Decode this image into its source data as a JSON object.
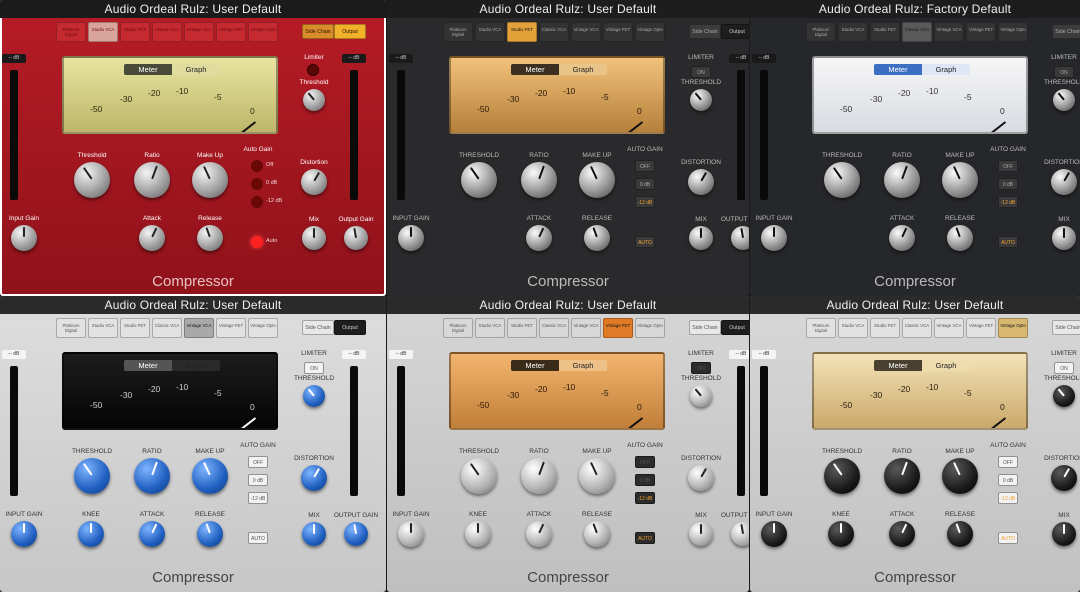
{
  "shared": {
    "tabs": [
      "Platinum Digital",
      "Studio VCA",
      "Studio FET",
      "Classic VCA",
      "Vintage VCA",
      "Vintage FET",
      "Vintage Opto"
    ],
    "side_chain": "Side Chain",
    "output": "Output",
    "meter": "Meter",
    "graph": "Graph",
    "scale": [
      "-50",
      "-30",
      "-20",
      "-10",
      "-5",
      "0"
    ],
    "footer": "Compressor",
    "db": "-- dB",
    "labels_upper": {
      "threshold": "THRESHOLD",
      "ratio": "RATIO",
      "makeup": "MAKE UP",
      "autogain": "AUTO GAIN",
      "attack": "ATTACK",
      "release": "RELEASE",
      "knee": "KNEE",
      "limiter": "LIMITER",
      "distortion": "DISTORTION",
      "mix": "MIX",
      "input_gain": "INPUT GAIN",
      "output_gain": "OUTPUT GAIN"
    },
    "labels_mixed": {
      "threshold": "Threshold",
      "ratio": "Ratio",
      "makeup": "Make Up",
      "autogain": "Auto Gain",
      "attack": "Attack",
      "release": "Release",
      "limiter": "Limiter",
      "distortion": "Distortion",
      "mix": "Mix",
      "input_gain": "Input Gain",
      "output_gain": "Output Gain"
    },
    "autogain_options": [
      "Off",
      "0 dB",
      "-12 dB",
      "Auto"
    ],
    "autogain_options_upper": [
      "OFF",
      "0 dB",
      "-12 dB",
      "AUTO"
    ],
    "on": "ON"
  },
  "panels": [
    {
      "title": "Audio Ordeal Rulz: User Default",
      "theme": "red",
      "active_tab": 1,
      "selected": true,
      "case": "mixed"
    },
    {
      "title": "Audio Ordeal Rulz: User Default",
      "theme": "dark",
      "active_tab": 2,
      "selected": false,
      "case": "upper"
    },
    {
      "title": "Audio Ordeal Rulz: Factory Default",
      "theme": "darkblue",
      "active_tab": 3,
      "selected": false,
      "case": "upper"
    },
    {
      "title": "Audio Ordeal Rulz: User Default",
      "theme": "silverblue",
      "active_tab": 4,
      "selected": false,
      "case": "upper"
    },
    {
      "title": "Audio Ordeal Rulz: User Default",
      "theme": "silver",
      "active_tab": 5,
      "selected": false,
      "case": "upper"
    },
    {
      "title": "Audio Ordeal Rulz: User Default",
      "theme": "silverblack",
      "active_tab": 6,
      "selected": false,
      "case": "upper"
    }
  ]
}
